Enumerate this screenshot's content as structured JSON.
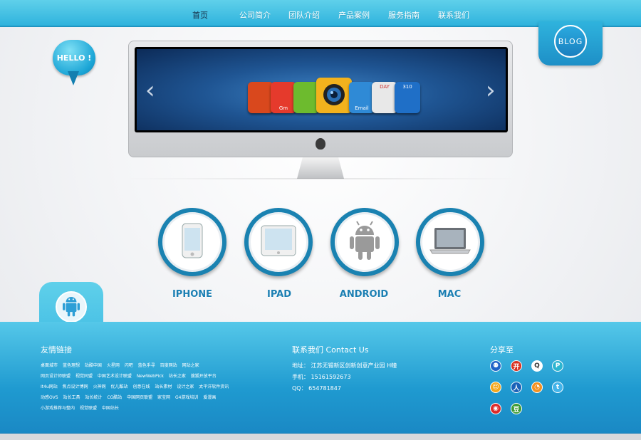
{
  "nav": {
    "items": [
      {
        "label": "首页",
        "active": true
      },
      {
        "label": "公司简介",
        "active": false
      },
      {
        "label": "团队介绍",
        "active": false
      },
      {
        "label": "产品案例",
        "active": false
      },
      {
        "label": "服务指南",
        "active": false
      },
      {
        "label": "联系我们",
        "active": false
      }
    ]
  },
  "blog_label": "BLOG",
  "hello_label": "HELLO !",
  "slider": {
    "apps": [
      {
        "label": "",
        "color": "#d9481d"
      },
      {
        "label": "Gm",
        "color": "#e53a2c"
      },
      {
        "label": "",
        "color": "#6dbb2e"
      },
      {
        "label": "",
        "color": "#f2b21d"
      },
      {
        "label": "Email",
        "color": "#2f8ad6"
      },
      {
        "label": "DAY",
        "color": "#e8e8e8"
      },
      {
        "label": "310",
        "color": "#1f6fc7"
      }
    ]
  },
  "devices": [
    {
      "label": "IPHONE",
      "icon": "iphone-icon"
    },
    {
      "label": "IPAD",
      "icon": "ipad-icon"
    },
    {
      "label": "ANDROID",
      "icon": "android-icon"
    },
    {
      "label": "MAC",
      "icon": "macbook-icon"
    }
  ],
  "footer": {
    "links_title": "友情链接",
    "links": [
      "桌面城市",
      "蓝色理想",
      "站酷中国",
      "火星网",
      "闪吧",
      "蓝色手寻",
      "百度网站",
      "网站之家",
      "网页设计师联盟",
      "视觉同盟",
      "中国艺术设计联盟",
      "NewWebPick",
      "站长之家",
      "搜狐开放平台",
      "It4u网站",
      "焦点设计博网",
      "火神网",
      "优儿酷站",
      "创意在线",
      "站长素材",
      "设计之家",
      "太平洋软件资讯",
      "动感OVS",
      "站长工具",
      "站长统计",
      "CG酷站",
      "中国网页联盟",
      "家宝网",
      "G4游戏培训",
      "爱漫画",
      "小游戏推荐与整内",
      "视觉联盟",
      "中国站长"
    ],
    "contact_title": "联系我们 Contact Us",
    "contact": {
      "address": "地址：  江苏无锡新区创新创意产业园 H幢",
      "phone": "手机：  15161592673",
      "qq": "  QQ：  654781847"
    },
    "share_title": "分享至",
    "share_icons": [
      {
        "name": "baidu-icon",
        "color": "#2064c8",
        "glyph": "⚉"
      },
      {
        "name": "kaixin-icon",
        "color": "#d8311f",
        "glyph": "开"
      },
      {
        "name": "qq-icon",
        "color": "#ffffff",
        "glyph": "Q"
      },
      {
        "name": "qzone-icon",
        "color": "#2bb5d0",
        "glyph": "P"
      },
      {
        "name": "taobao-icon",
        "color": "#f4a71c",
        "glyph": "☺"
      },
      {
        "name": "renren-icon",
        "color": "#1a62b8",
        "glyph": "人"
      },
      {
        "name": "rss-icon",
        "color": "#f39121",
        "glyph": "◔"
      },
      {
        "name": "twitter-icon",
        "color": "#43b4ea",
        "glyph": "t"
      },
      {
        "name": "weibo-icon",
        "color": "#dd2b29",
        "glyph": "◉"
      },
      {
        "name": "douban-icon",
        "color": "#3d9b34",
        "glyph": "豆"
      }
    ]
  }
}
